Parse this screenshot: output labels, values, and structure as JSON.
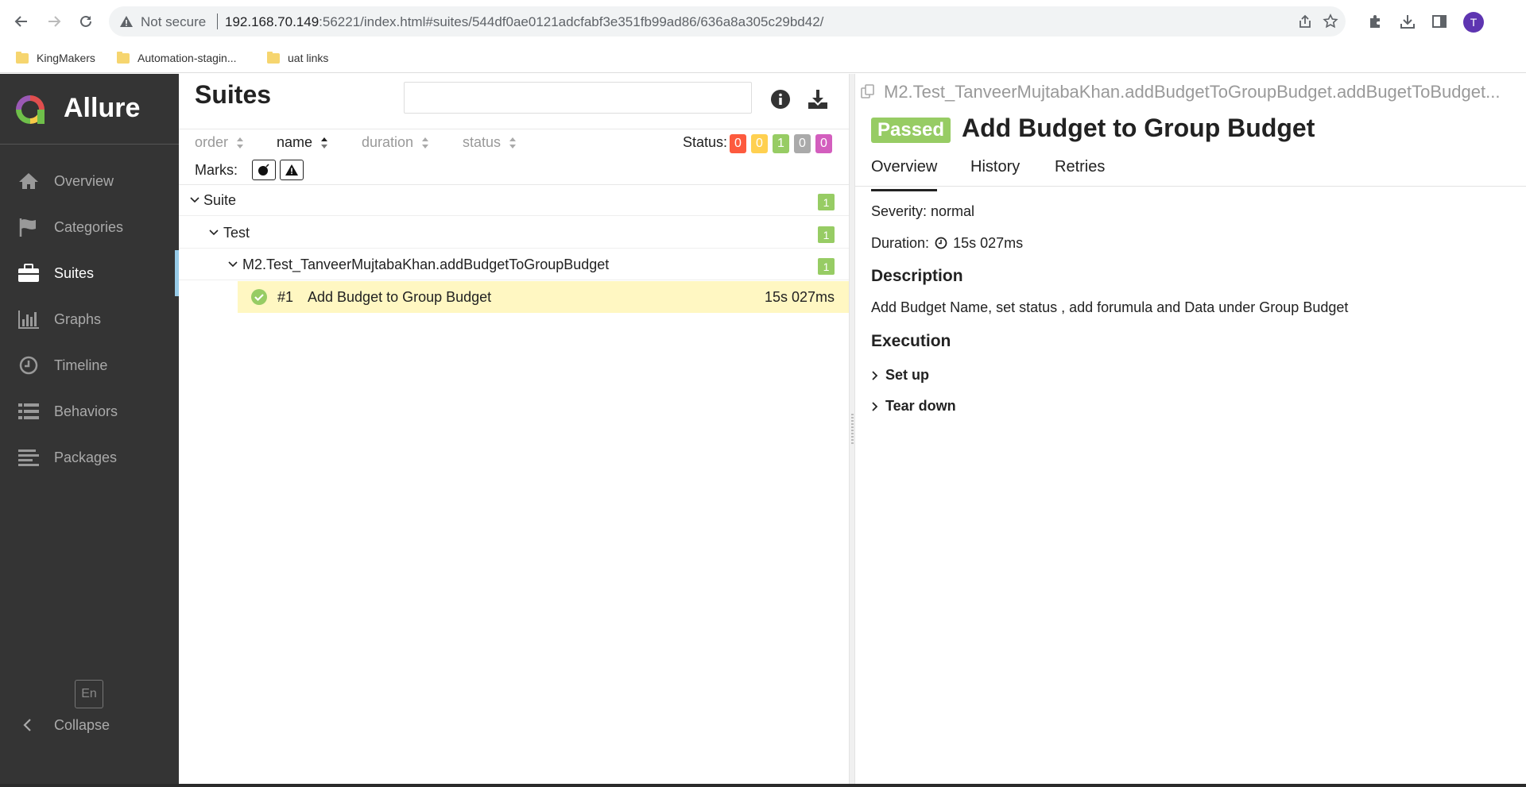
{
  "browser": {
    "security_label": "Not secure",
    "url_host": "192.168.70.149",
    "url_rest": ":56221/index.html#suites/544df0ae0121adcfabf3e351fb99ad86/636a8a305c29bd42/",
    "profile_initial": "T",
    "bookmarks": [
      "KingMakers",
      "Automation-stagin...",
      "uat links"
    ]
  },
  "app": {
    "brand": "Allure",
    "menu": [
      {
        "label": "Overview",
        "icon": "home-icon"
      },
      {
        "label": "Categories",
        "icon": "flag-icon"
      },
      {
        "label": "Suites",
        "icon": "briefcase-icon"
      },
      {
        "label": "Graphs",
        "icon": "bar-chart-icon"
      },
      {
        "label": "Timeline",
        "icon": "clock-icon"
      },
      {
        "label": "Behaviors",
        "icon": "list-icon"
      },
      {
        "label": "Packages",
        "icon": "align-left-icon"
      }
    ],
    "active_menu": "Suites",
    "language": "En",
    "collapse_label": "Collapse"
  },
  "suites_pane": {
    "title": "Suites",
    "search_value": "",
    "sorters": [
      "order",
      "name",
      "duration",
      "status"
    ],
    "active_sorter": "name",
    "status_label": "Status:",
    "status_counts": [
      {
        "value": "0",
        "color": "#fd5a3e"
      },
      {
        "value": "0",
        "color": "#ffd050"
      },
      {
        "value": "1",
        "color": "#97cc64"
      },
      {
        "value": "0",
        "color": "#aaaaaa"
      },
      {
        "value": "0",
        "color": "#d35ebe"
      }
    ],
    "marks_label": "Marks:",
    "tree": [
      {
        "label": "Suite",
        "count": "1"
      },
      {
        "label": "Test",
        "count": "1"
      },
      {
        "label": "M2.Test_TanveerMujtabaKhan.addBudgetToGroupBudget",
        "count": "1"
      }
    ],
    "case": {
      "number": "#1",
      "name": "Add Budget to Group Budget",
      "duration": "15s 027ms"
    }
  },
  "detail": {
    "path": "M2.Test_TanveerMujtabaKhan.addBudgetToGroupBudget.addBugetToBudget...",
    "status": "Passed",
    "title": "Add Budget to Group Budget",
    "tabs": [
      "Overview",
      "History",
      "Retries"
    ],
    "active_tab": "Overview",
    "severity": "Severity: normal",
    "duration_label": "Duration:",
    "duration_value": "15s 027ms",
    "description_heading": "Description",
    "description": "Add Budget Name, set status , add forumula and Data under Group Budget",
    "execution_heading": "Execution",
    "steps": [
      "Set up",
      "Tear down"
    ]
  }
}
